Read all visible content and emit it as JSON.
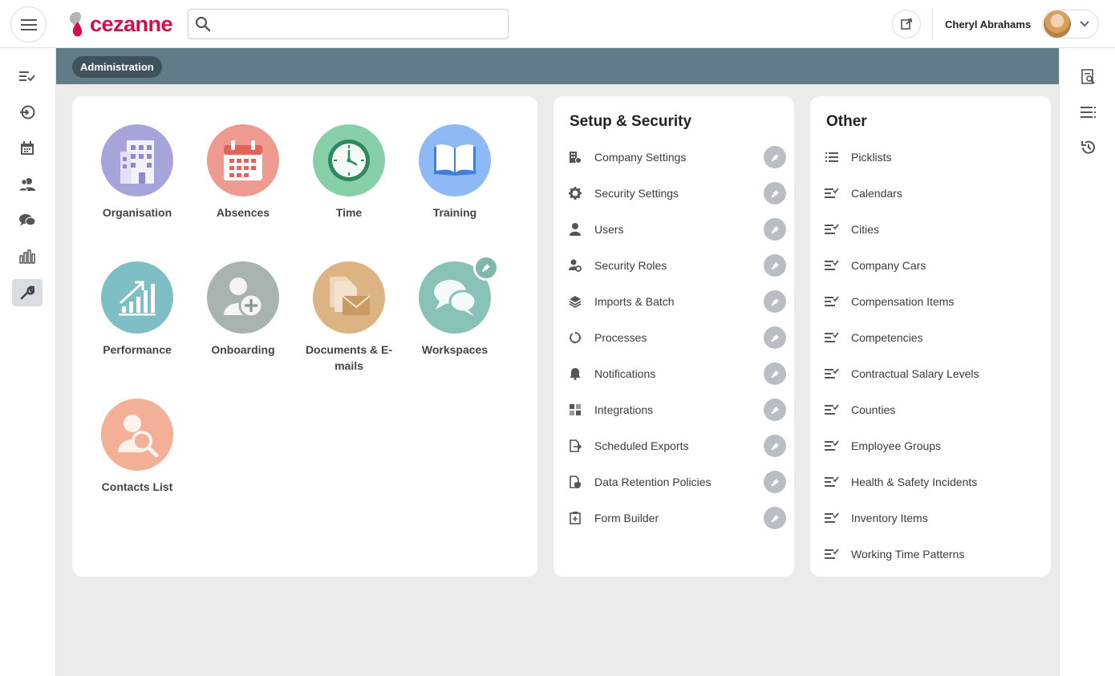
{
  "header": {
    "brand": "cezanne",
    "search_placeholder": "",
    "user_name": "Cheryl Abrahams"
  },
  "breadcrumb": "Administration",
  "modules": [
    {
      "label": "Organisation",
      "color": "#a6a5d9",
      "icon": "building-icon"
    },
    {
      "label": "Absences",
      "color": "#ee9a91",
      "icon": "calendar-icon"
    },
    {
      "label": "Time",
      "color": "#86cfa9",
      "icon": "clock-icon"
    },
    {
      "label": "Training",
      "color": "#8fb9f5",
      "icon": "open-book-icon"
    },
    {
      "label": "Performance",
      "color": "#7dbfc4",
      "icon": "growth-chart-icon"
    },
    {
      "label": "Onboarding",
      "color": "#a8b2ae",
      "icon": "add-person-icon"
    },
    {
      "label": "Documents & E-mails",
      "color": "#dcb483",
      "icon": "document-mail-icon"
    },
    {
      "label": "Workspaces",
      "color": "#88c1b6",
      "icon": "chat-bubbles-icon",
      "pinned": true
    },
    {
      "label": "Contacts List",
      "color": "#f3b096",
      "icon": "person-search-icon"
    }
  ],
  "setup": {
    "title": "Setup & Security",
    "items": [
      {
        "label": "Company Settings",
        "icon": "company-settings-icon"
      },
      {
        "label": "Security Settings",
        "icon": "gear-icon"
      },
      {
        "label": "Users",
        "icon": "user-icon"
      },
      {
        "label": "Security Roles",
        "icon": "user-gear-icon"
      },
      {
        "label": "Imports & Batch",
        "icon": "layers-icon"
      },
      {
        "label": "Processes",
        "icon": "cycle-icon"
      },
      {
        "label": "Notifications",
        "icon": "bell-icon"
      },
      {
        "label": "Integrations",
        "icon": "puzzle-icon"
      },
      {
        "label": "Scheduled Exports",
        "icon": "export-file-icon"
      },
      {
        "label": "Data Retention Policies",
        "icon": "file-shield-icon"
      },
      {
        "label": "Form Builder",
        "icon": "form-builder-icon"
      }
    ]
  },
  "other": {
    "title": "Other",
    "items": [
      {
        "label": "Picklists",
        "icon": "list-icon"
      },
      {
        "label": "Calendars",
        "icon": "checklist-icon"
      },
      {
        "label": "Cities",
        "icon": "checklist-icon"
      },
      {
        "label": "Company Cars",
        "icon": "checklist-icon"
      },
      {
        "label": "Compensation Items",
        "icon": "checklist-icon"
      },
      {
        "label": "Competencies",
        "icon": "checklist-icon"
      },
      {
        "label": "Contractual Salary Levels",
        "icon": "checklist-icon"
      },
      {
        "label": "Counties",
        "icon": "checklist-icon"
      },
      {
        "label": "Employee Groups",
        "icon": "checklist-icon"
      },
      {
        "label": "Health & Safety Incidents",
        "icon": "checklist-icon"
      },
      {
        "label": "Inventory Items",
        "icon": "checklist-icon"
      },
      {
        "label": "Working Time Patterns",
        "icon": "checklist-icon"
      }
    ]
  },
  "left_nav": [
    "tasks-icon",
    "login-icon",
    "calendar-icon",
    "people-icon",
    "chat-icon",
    "bar-chart-icon",
    "wrench-icon"
  ],
  "right_nav": [
    "search-document-icon",
    "list-menu-icon",
    "history-icon"
  ],
  "colors": {
    "brand": "#d0104c",
    "band": "#617b89",
    "breadcrumb_bg": "#40525c",
    "pin": "#b8bec4"
  }
}
